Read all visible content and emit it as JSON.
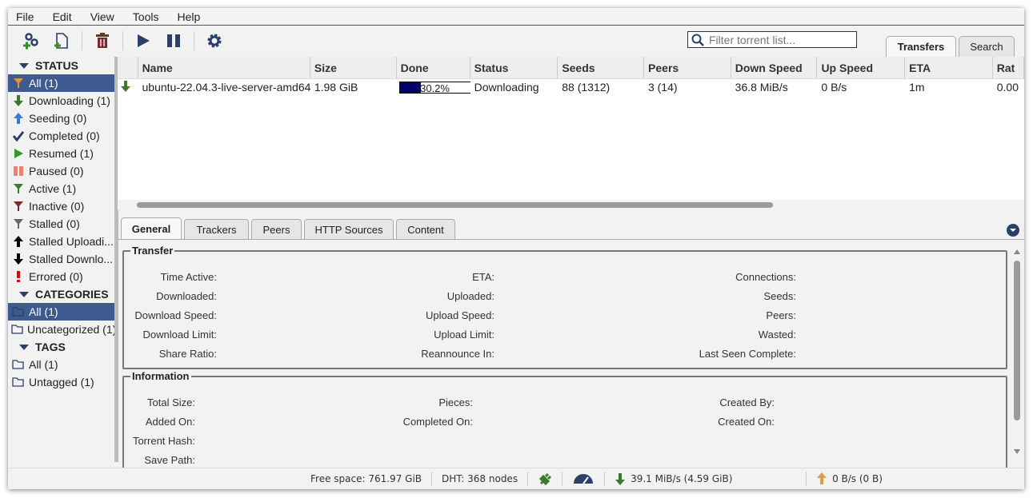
{
  "menu": [
    "File",
    "Edit",
    "View",
    "Tools",
    "Help"
  ],
  "toolbar": {
    "icons": [
      "add-link-icon",
      "add-file-icon",
      "delete-icon",
      "resume-icon",
      "pause-icon",
      "settings-icon"
    ]
  },
  "search": {
    "placeholder": "Filter torrent list..."
  },
  "main_tabs": [
    "Transfers",
    "Search"
  ],
  "sidebar": {
    "status_header": "STATUS",
    "status": [
      "All (1)",
      "Downloading (1)",
      "Seeding (0)",
      "Completed (0)",
      "Resumed (1)",
      "Paused (0)",
      "Active (1)",
      "Inactive (0)",
      "Stalled (0)",
      "Stalled Uploadi...",
      "Stalled Downlo...",
      "Errored (0)"
    ],
    "categories_header": "CATEGORIES",
    "categories": [
      "All (1)",
      "Uncategorized (1)"
    ],
    "tags_header": "TAGS",
    "tags": [
      "All (1)",
      "Untagged (1)"
    ]
  },
  "table": {
    "columns": [
      "Name",
      "Size",
      "Done",
      "Status",
      "Seeds",
      "Peers",
      "Down Speed",
      "Up Speed",
      "ETA",
      "Rat"
    ],
    "rows": [
      {
        "name": "ubuntu-22.04.3-live-server-amd64...",
        "size": "1.98 GiB",
        "done": "30.2%",
        "progress": 30.2,
        "status": "Downloading",
        "seeds": "88 (1312)",
        "peers": "3 (14)",
        "down": "36.8 MiB/s",
        "up": "0 B/s",
        "eta": "1m",
        "ratio": "0.00"
      }
    ]
  },
  "detail_tabs": [
    "General",
    "Trackers",
    "Peers",
    "HTTP Sources",
    "Content"
  ],
  "transfer": {
    "title": "Transfer",
    "col1": [
      "Time Active:",
      "Downloaded:",
      "Download Speed:",
      "Download Limit:",
      "Share Ratio:"
    ],
    "col2": [
      "ETA:",
      "Uploaded:",
      "Upload Speed:",
      "Upload Limit:",
      "Reannounce In:"
    ],
    "col3": [
      "Connections:",
      "Seeds:",
      "Peers:",
      "Wasted:",
      "Last Seen Complete:"
    ]
  },
  "information": {
    "title": "Information",
    "col1": [
      "Total Size:",
      "Added On:",
      "Torrent Hash:",
      "Save Path:"
    ],
    "col2": [
      "Pieces:",
      "Completed On:"
    ],
    "col3": [
      "Created By:",
      "Created On:"
    ]
  },
  "statusbar": {
    "free_space": "Free space: 761.97 GiB",
    "dht": "DHT: 368 nodes",
    "download": "39.1 MiB/s (4.59 GiB)",
    "upload": "0 B/s (0 B)"
  },
  "colors": {
    "selection": "#3f5a8f",
    "progress": "#000066",
    "download": "#3c7a2b",
    "upload": "#e09a45"
  }
}
